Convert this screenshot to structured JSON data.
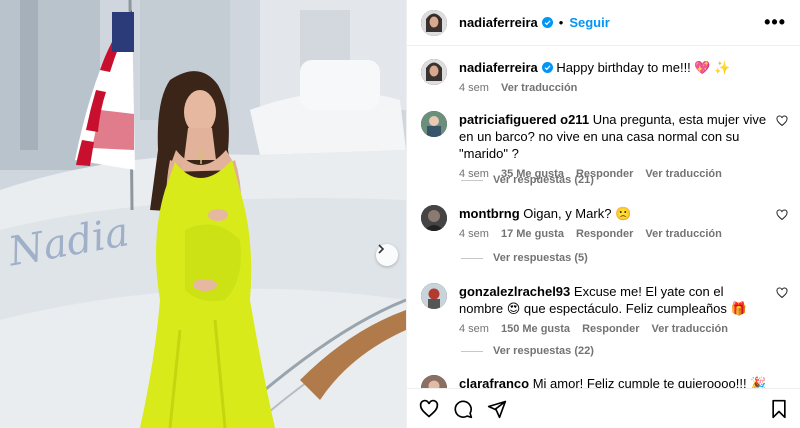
{
  "post": {
    "author": "nadiaferreira",
    "follow_label": "Seguir",
    "more_label": "•••",
    "caption_text": "Happy birthday to me!!! 💖 ✨",
    "caption_time": "4 sem",
    "caption_translate": "Ver traducción",
    "photo_boat_text": "Nadia"
  },
  "comments": [
    {
      "user": "patriciafiguered o211",
      "text": "Una pregunta, esta mujer vive en un barco? no vive en una casa normal con su \"marido\" ?",
      "time": "4 sem",
      "likes": "35 Me gusta",
      "reply": "Responder",
      "translate": "Ver traducción",
      "replies": "Ver respuestas (21)"
    },
    {
      "user": "montbrng",
      "text": "Oigan, y Mark? 🙁",
      "time": "4 sem",
      "likes": "17 Me gusta",
      "reply": "Responder",
      "translate": "Ver traducción",
      "replies": "Ver respuestas (5)"
    },
    {
      "user": "gonzalezlrachel93",
      "text": "Excuse me! El yate con el nombre 😍 que espectáculo. Feliz cumpleaños 🎁",
      "time": "4 sem",
      "likes": "150 Me gusta",
      "reply": "Responder",
      "translate": "Ver traducción",
      "replies": "Ver respuestas (22)"
    },
    {
      "user": "clarafranco",
      "text": "Mi amor! Feliz cumple te quieroooo!!! 🎉 😍"
    }
  ],
  "colors": {
    "accent": "#0095f6",
    "muted": "#737373",
    "dress": "#d8ea1a"
  },
  "icons": [
    "heart-icon",
    "comment-icon",
    "share-icon",
    "bookmark-icon",
    "chevron-right-icon",
    "verified-badge-icon",
    "more-icon"
  ]
}
